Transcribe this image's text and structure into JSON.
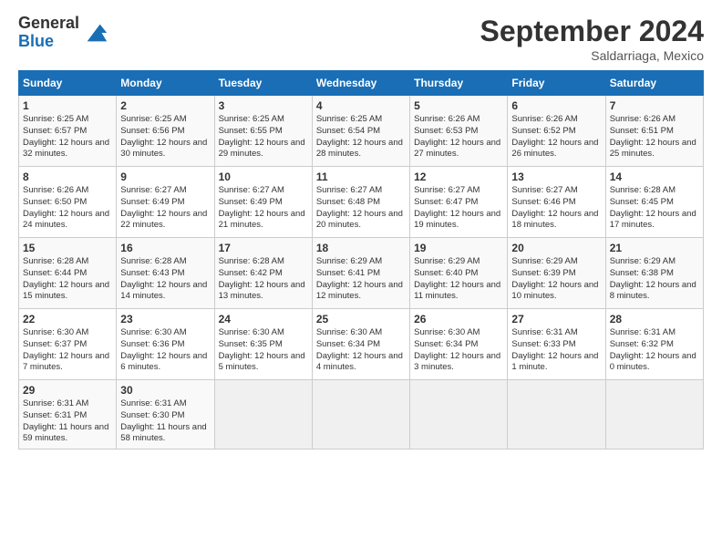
{
  "header": {
    "logo_general": "General",
    "logo_blue": "Blue",
    "month_title": "September 2024",
    "location": "Saldarriaga, Mexico"
  },
  "weekdays": [
    "Sunday",
    "Monday",
    "Tuesday",
    "Wednesday",
    "Thursday",
    "Friday",
    "Saturday"
  ],
  "weeks": [
    [
      {
        "day": "1",
        "sunrise": "6:25 AM",
        "sunset": "6:57 PM",
        "daylight": "12 hours and 32 minutes."
      },
      {
        "day": "2",
        "sunrise": "6:25 AM",
        "sunset": "6:56 PM",
        "daylight": "12 hours and 30 minutes."
      },
      {
        "day": "3",
        "sunrise": "6:25 AM",
        "sunset": "6:55 PM",
        "daylight": "12 hours and 29 minutes."
      },
      {
        "day": "4",
        "sunrise": "6:25 AM",
        "sunset": "6:54 PM",
        "daylight": "12 hours and 28 minutes."
      },
      {
        "day": "5",
        "sunrise": "6:26 AM",
        "sunset": "6:53 PM",
        "daylight": "12 hours and 27 minutes."
      },
      {
        "day": "6",
        "sunrise": "6:26 AM",
        "sunset": "6:52 PM",
        "daylight": "12 hours and 26 minutes."
      },
      {
        "day": "7",
        "sunrise": "6:26 AM",
        "sunset": "6:51 PM",
        "daylight": "12 hours and 25 minutes."
      }
    ],
    [
      {
        "day": "8",
        "sunrise": "6:26 AM",
        "sunset": "6:50 PM",
        "daylight": "12 hours and 24 minutes."
      },
      {
        "day": "9",
        "sunrise": "6:27 AM",
        "sunset": "6:49 PM",
        "daylight": "12 hours and 22 minutes."
      },
      {
        "day": "10",
        "sunrise": "6:27 AM",
        "sunset": "6:49 PM",
        "daylight": "12 hours and 21 minutes."
      },
      {
        "day": "11",
        "sunrise": "6:27 AM",
        "sunset": "6:48 PM",
        "daylight": "12 hours and 20 minutes."
      },
      {
        "day": "12",
        "sunrise": "6:27 AM",
        "sunset": "6:47 PM",
        "daylight": "12 hours and 19 minutes."
      },
      {
        "day": "13",
        "sunrise": "6:27 AM",
        "sunset": "6:46 PM",
        "daylight": "12 hours and 18 minutes."
      },
      {
        "day": "14",
        "sunrise": "6:28 AM",
        "sunset": "6:45 PM",
        "daylight": "12 hours and 17 minutes."
      }
    ],
    [
      {
        "day": "15",
        "sunrise": "6:28 AM",
        "sunset": "6:44 PM",
        "daylight": "12 hours and 15 minutes."
      },
      {
        "day": "16",
        "sunrise": "6:28 AM",
        "sunset": "6:43 PM",
        "daylight": "12 hours and 14 minutes."
      },
      {
        "day": "17",
        "sunrise": "6:28 AM",
        "sunset": "6:42 PM",
        "daylight": "12 hours and 13 minutes."
      },
      {
        "day": "18",
        "sunrise": "6:29 AM",
        "sunset": "6:41 PM",
        "daylight": "12 hours and 12 minutes."
      },
      {
        "day": "19",
        "sunrise": "6:29 AM",
        "sunset": "6:40 PM",
        "daylight": "12 hours and 11 minutes."
      },
      {
        "day": "20",
        "sunrise": "6:29 AM",
        "sunset": "6:39 PM",
        "daylight": "12 hours and 10 minutes."
      },
      {
        "day": "21",
        "sunrise": "6:29 AM",
        "sunset": "6:38 PM",
        "daylight": "12 hours and 8 minutes."
      }
    ],
    [
      {
        "day": "22",
        "sunrise": "6:30 AM",
        "sunset": "6:37 PM",
        "daylight": "12 hours and 7 minutes."
      },
      {
        "day": "23",
        "sunrise": "6:30 AM",
        "sunset": "6:36 PM",
        "daylight": "12 hours and 6 minutes."
      },
      {
        "day": "24",
        "sunrise": "6:30 AM",
        "sunset": "6:35 PM",
        "daylight": "12 hours and 5 minutes."
      },
      {
        "day": "25",
        "sunrise": "6:30 AM",
        "sunset": "6:34 PM",
        "daylight": "12 hours and 4 minutes."
      },
      {
        "day": "26",
        "sunrise": "6:30 AM",
        "sunset": "6:34 PM",
        "daylight": "12 hours and 3 minutes."
      },
      {
        "day": "27",
        "sunrise": "6:31 AM",
        "sunset": "6:33 PM",
        "daylight": "12 hours and 1 minute."
      },
      {
        "day": "28",
        "sunrise": "6:31 AM",
        "sunset": "6:32 PM",
        "daylight": "12 hours and 0 minutes."
      }
    ],
    [
      {
        "day": "29",
        "sunrise": "6:31 AM",
        "sunset": "6:31 PM",
        "daylight": "11 hours and 59 minutes."
      },
      {
        "day": "30",
        "sunrise": "6:31 AM",
        "sunset": "6:30 PM",
        "daylight": "11 hours and 58 minutes."
      },
      null,
      null,
      null,
      null,
      null
    ]
  ]
}
